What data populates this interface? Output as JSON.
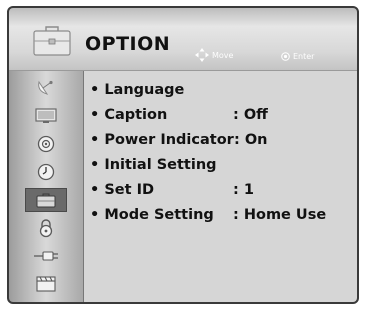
{
  "header": {
    "title": "OPTION",
    "hints": {
      "move_label": "Move",
      "enter_label": "Enter"
    }
  },
  "sidebar": {
    "items": [
      {
        "icon": "satellite-dish-icon",
        "selected": false
      },
      {
        "icon": "monitor-icon",
        "selected": false
      },
      {
        "icon": "disc-icon",
        "selected": false
      },
      {
        "icon": "clock-icon",
        "selected": false
      },
      {
        "icon": "briefcase-icon",
        "selected": true
      },
      {
        "icon": "lock-icon",
        "selected": false
      },
      {
        "icon": "cable-plug-icon",
        "selected": false
      },
      {
        "icon": "clapperboard-icon",
        "selected": false
      }
    ]
  },
  "menu": {
    "items": [
      {
        "label": "• Language",
        "value": ""
      },
      {
        "label": "• Caption",
        "value": ": Off"
      },
      {
        "label": "• Power Indicator",
        "value": ": On"
      },
      {
        "label": "• Initial Setting",
        "value": ""
      },
      {
        "label": "• Set ID",
        "value": ": 1"
      },
      {
        "label": "• Mode Setting",
        "value": ": Home Use"
      }
    ]
  }
}
